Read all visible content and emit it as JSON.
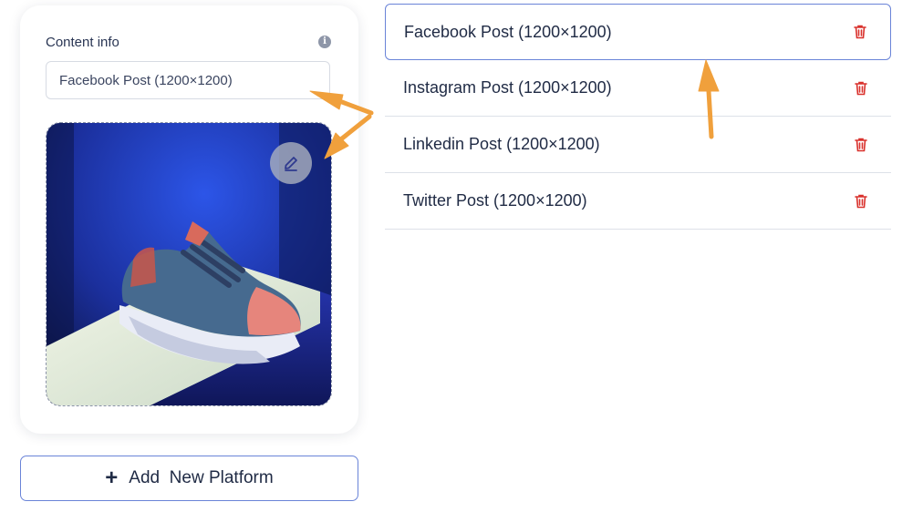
{
  "content_card": {
    "title": "Content info",
    "info_icon": "i",
    "name_value": "Facebook Post (1200×1200)"
  },
  "image": {
    "description_icon": "sneaker-image",
    "edit_icon": "pencil-icon"
  },
  "add_platform": {
    "plus": "+",
    "label": "Add  New Platform"
  },
  "platforms": [
    {
      "label": "Facebook Post (1200×1200)",
      "selected": true
    },
    {
      "label": "Instagram Post (1200×1200)",
      "selected": false
    },
    {
      "label": "Linkedin Post (1200×1200)",
      "selected": false
    },
    {
      "label": "Twitter Post (1200×1200)",
      "selected": false
    }
  ],
  "colors": {
    "accent": "#6a84d8",
    "delete": "#d9312c",
    "annotation": "#f0a03c"
  }
}
